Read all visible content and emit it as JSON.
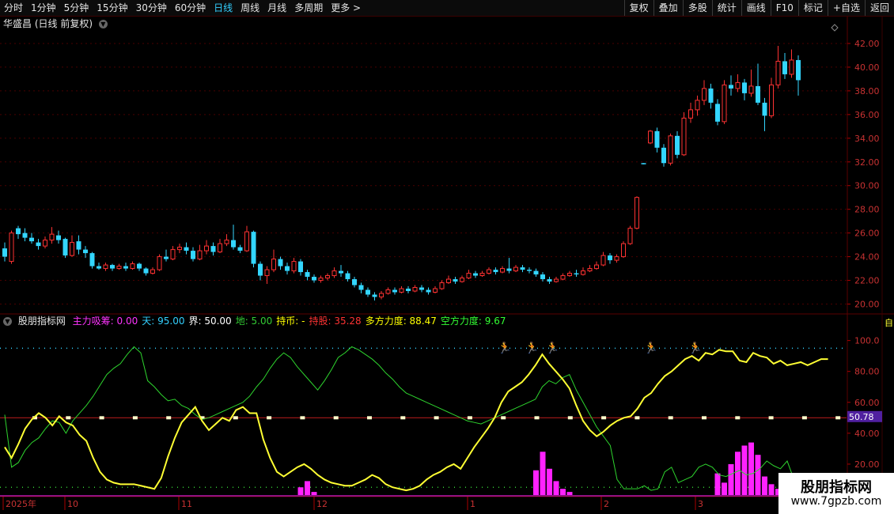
{
  "toolbar": {
    "periods": [
      "分时",
      "1分钟",
      "5分钟",
      "15分钟",
      "30分钟",
      "60分钟",
      "日线",
      "周线",
      "月线",
      "多周期",
      "更多 >"
    ],
    "active_index": 6,
    "tools": [
      "复权",
      "叠加",
      "多股",
      "统计",
      "画线",
      "F10",
      "标记",
      "+自选",
      "返回"
    ]
  },
  "title": {
    "name": "华盛昌",
    "mode": "(日线 前复权)"
  },
  "price_axis": [
    "42.00",
    "40.00",
    "38.00",
    "36.00",
    "34.00",
    "32.00",
    "30.00",
    "28.00",
    "26.00",
    "24.00",
    "22.00",
    "20.00"
  ],
  "indicator": {
    "name": "股朋指标网",
    "fields": [
      {
        "label": "主力吸筹:",
        "value": "0.00",
        "color": "#ff33ff"
      },
      {
        "label": "天:",
        "value": "95.00",
        "color": "#33d0ff"
      },
      {
        "label": "界:",
        "value": "50.00",
        "color": "#ffffff"
      },
      {
        "label": "地:",
        "value": "5.00",
        "color": "#33cc33"
      },
      {
        "label": "持币:",
        "value": "-",
        "color": "#ffff00"
      },
      {
        "label": "持股:",
        "value": "35.28",
        "color": "#ff3333"
      },
      {
        "label": "多方力度:",
        "value": "88.47",
        "color": "#ffff00"
      },
      {
        "label": "空方力度:",
        "value": "9.67",
        "color": "#33ff33"
      }
    ],
    "axis": [
      "100.0",
      "80.00",
      "60.00",
      "40.00",
      "20.00"
    ],
    "current_value": "50.78",
    "right_stub": "自"
  },
  "timeline": [
    "2025年",
    "10",
    "11",
    "12",
    "1",
    "2",
    "3"
  ],
  "watermark": {
    "line1": "股朋指标网",
    "line2": "www.7gpzb.com"
  },
  "colors": {
    "up": "#ff3232",
    "down": "#33d6ff",
    "yellow": "#ffff33",
    "green": "#2ed42e",
    "magenta": "#ff22ff"
  },
  "chart_data": {
    "type": "candlestick",
    "ylim": [
      19.5,
      43
    ],
    "candles": [
      [
        24.7,
        24.0,
        25.2,
        23.6
      ],
      [
        23.6,
        26.0,
        26.2,
        23.4
      ],
      [
        26.4,
        25.9,
        26.6,
        25.5
      ],
      [
        26.0,
        25.6,
        26.4,
        25.3
      ],
      [
        25.6,
        25.3,
        26.0,
        25.1
      ],
      [
        25.2,
        24.9,
        25.5,
        24.6
      ],
      [
        24.9,
        25.4,
        25.7,
        24.7
      ],
      [
        25.4,
        25.9,
        26.5,
        25.1
      ],
      [
        25.8,
        25.4,
        26.2,
        25.1
      ],
      [
        25.5,
        24.1,
        25.6,
        23.9
      ],
      [
        24.1,
        25.2,
        25.8,
        24.0
      ],
      [
        25.3,
        24.6,
        25.8,
        24.2
      ],
      [
        24.6,
        24.3,
        24.9,
        23.9
      ],
      [
        24.3,
        23.2,
        24.4,
        23.0
      ],
      [
        23.2,
        23.0,
        23.5,
        22.9
      ],
      [
        23.0,
        23.3,
        23.5,
        22.8
      ],
      [
        23.3,
        23.0,
        23.4,
        22.8
      ],
      [
        23.0,
        23.2,
        23.4,
        22.9
      ],
      [
        23.2,
        23.0,
        23.5,
        22.8
      ],
      [
        23.0,
        23.4,
        23.6,
        22.9
      ],
      [
        23.4,
        23.0,
        23.5,
        22.8
      ],
      [
        23.0,
        22.6,
        23.1,
        22.4
      ],
      [
        22.6,
        22.9,
        23.1,
        22.5
      ],
      [
        22.9,
        24.0,
        24.2,
        22.8
      ],
      [
        24.0,
        23.8,
        24.6,
        23.6
      ],
      [
        23.8,
        24.6,
        24.9,
        23.7
      ],
      [
        24.6,
        24.8,
        25.1,
        24.3
      ],
      [
        24.8,
        24.5,
        25.2,
        24.2
      ],
      [
        24.5,
        23.8,
        24.8,
        23.6
      ],
      [
        23.8,
        24.5,
        25.0,
        23.7
      ],
      [
        24.5,
        24.9,
        25.4,
        24.2
      ],
      [
        24.9,
        24.4,
        25.2,
        24.1
      ],
      [
        24.4,
        25.1,
        25.5,
        24.3
      ],
      [
        25.1,
        25.4,
        25.9,
        24.9
      ],
      [
        25.4,
        24.8,
        26.7,
        24.6
      ],
      [
        24.8,
        24.5,
        25.0,
        24.3
      ],
      [
        24.5,
        26.1,
        26.6,
        24.4
      ],
      [
        26.1,
        23.4,
        26.2,
        23.1
      ],
      [
        23.4,
        22.4,
        23.6,
        22.0
      ],
      [
        22.4,
        22.9,
        23.2,
        21.7
      ],
      [
        22.9,
        23.8,
        24.6,
        22.7
      ],
      [
        23.8,
        23.2,
        24.0,
        22.9
      ],
      [
        23.2,
        22.8,
        23.5,
        22.5
      ],
      [
        22.8,
        23.6,
        23.9,
        22.6
      ],
      [
        23.6,
        22.7,
        23.8,
        22.4
      ],
      [
        22.7,
        22.3,
        22.9,
        22.0
      ],
      [
        22.3,
        22.0,
        22.5,
        21.8
      ],
      [
        22.0,
        22.2,
        22.4,
        21.8
      ],
      [
        22.2,
        22.4,
        22.6,
        22.0
      ],
      [
        22.4,
        22.8,
        23.1,
        22.2
      ],
      [
        22.8,
        22.6,
        23.3,
        22.3
      ],
      [
        22.6,
        22.1,
        22.8,
        21.9
      ],
      [
        22.1,
        21.6,
        22.3,
        21.4
      ],
      [
        21.6,
        21.2,
        21.8,
        20.9
      ],
      [
        21.2,
        20.8,
        21.4,
        20.6
      ],
      [
        20.8,
        20.6,
        21.0,
        20.3
      ],
      [
        20.6,
        20.9,
        21.1,
        20.4
      ],
      [
        20.9,
        21.2,
        21.4,
        20.8
      ],
      [
        21.2,
        21.0,
        21.4,
        20.8
      ],
      [
        21.0,
        21.3,
        21.5,
        20.9
      ],
      [
        21.3,
        21.1,
        21.5,
        20.9
      ],
      [
        21.1,
        21.4,
        21.6,
        21.0
      ],
      [
        21.4,
        21.2,
        21.6,
        21.0
      ],
      [
        21.2,
        21.0,
        21.4,
        20.8
      ],
      [
        21.0,
        21.3,
        21.5,
        20.9
      ],
      [
        21.3,
        21.8,
        22.0,
        21.2
      ],
      [
        21.8,
        22.1,
        22.4,
        21.7
      ],
      [
        22.1,
        21.9,
        22.3,
        21.7
      ],
      [
        21.9,
        22.2,
        22.4,
        21.8
      ],
      [
        22.2,
        22.6,
        22.9,
        22.1
      ],
      [
        22.6,
        22.4,
        22.8,
        22.2
      ],
      [
        22.4,
        22.6,
        22.8,
        22.3
      ],
      [
        22.6,
        22.9,
        23.1,
        22.5
      ],
      [
        22.9,
        22.7,
        23.1,
        22.5
      ],
      [
        22.7,
        23.0,
        23.2,
        22.6
      ],
      [
        23.0,
        22.8,
        23.9,
        22.6
      ],
      [
        22.8,
        23.1,
        23.3,
        22.7
      ],
      [
        23.1,
        22.9,
        23.3,
        22.7
      ],
      [
        22.9,
        22.8,
        23.1,
        22.6
      ],
      [
        22.8,
        22.5,
        23.0,
        22.3
      ],
      [
        22.5,
        22.1,
        22.7,
        21.9
      ],
      [
        22.1,
        21.9,
        22.3,
        21.7
      ],
      [
        21.9,
        22.1,
        22.3,
        21.8
      ],
      [
        22.1,
        22.4,
        22.6,
        22.0
      ],
      [
        22.4,
        22.6,
        22.8,
        22.3
      ],
      [
        22.6,
        22.5,
        22.9,
        22.3
      ],
      [
        22.5,
        22.8,
        23.1,
        22.4
      ],
      [
        22.8,
        23.0,
        23.3,
        22.7
      ],
      [
        23.0,
        23.3,
        23.6,
        22.9
      ],
      [
        23.3,
        24.1,
        24.4,
        23.2
      ],
      [
        24.1,
        23.7,
        24.3,
        23.4
      ],
      [
        23.7,
        24.0,
        24.2,
        23.5
      ],
      [
        24.0,
        25.1,
        25.3,
        23.9
      ],
      [
        25.1,
        26.4,
        26.6,
        25.0
      ],
      [
        26.4,
        29.0,
        29.1,
        26.3
      ],
      [
        31.9,
        31.8,
        31.9,
        31.8
      ],
      [
        33.6,
        34.6,
        34.7,
        33.5
      ],
      [
        34.6,
        33.2,
        34.9,
        32.8
      ],
      [
        33.2,
        31.9,
        33.5,
        31.6
      ],
      [
        31.9,
        34.2,
        34.4,
        31.7
      ],
      [
        34.2,
        32.6,
        34.6,
        32.3
      ],
      [
        32.6,
        35.7,
        36.2,
        32.5
      ],
      [
        35.7,
        36.4,
        37.0,
        35.3
      ],
      [
        36.4,
        37.2,
        37.6,
        35.9
      ],
      [
        37.2,
        38.2,
        38.9,
        36.8
      ],
      [
        38.2,
        37.0,
        38.6,
        36.5
      ],
      [
        36.9,
        35.4,
        37.3,
        35.1
      ],
      [
        35.4,
        38.5,
        38.9,
        35.2
      ],
      [
        38.5,
        38.2,
        39.3,
        37.6
      ],
      [
        38.2,
        38.7,
        39.4,
        37.9
      ],
      [
        38.7,
        37.8,
        39.0,
        37.2
      ],
      [
        37.8,
        38.4,
        39.8,
        37.5
      ],
      [
        38.4,
        37.0,
        40.3,
        36.8
      ],
      [
        37.0,
        35.9,
        37.4,
        34.6
      ],
      [
        35.9,
        38.5,
        39.1,
        35.7
      ],
      [
        38.5,
        40.5,
        41.8,
        38.2
      ],
      [
        40.5,
        39.4,
        41.2,
        39.0
      ],
      [
        39.4,
        40.6,
        41.5,
        39.1
      ],
      [
        40.6,
        38.9,
        41.0,
        37.6
      ]
    ],
    "indicator_series": {
      "yellow": [
        31,
        24,
        33,
        43,
        49,
        53,
        50,
        45,
        51,
        47,
        45,
        39,
        35,
        24,
        15,
        10,
        8,
        7,
        7,
        7,
        6,
        5,
        4,
        11,
        25,
        37,
        47,
        52,
        57,
        48,
        42,
        46,
        50,
        48,
        55,
        57,
        53,
        53,
        36,
        24,
        15,
        12,
        15,
        18,
        20,
        17,
        13,
        10,
        8,
        7,
        6,
        6,
        8,
        10,
        13,
        11,
        7,
        5,
        4,
        3,
        4,
        6,
        10,
        13,
        15,
        18,
        20,
        17,
        24,
        31,
        37,
        43,
        50,
        60,
        67,
        70,
        73,
        78,
        84,
        91,
        85,
        80,
        75,
        69,
        58,
        48,
        42,
        38,
        41,
        45,
        48,
        50,
        51,
        56,
        63,
        66,
        72,
        77,
        80,
        84,
        88,
        90,
        87,
        92,
        91,
        94,
        93,
        93,
        87,
        86,
        92,
        90,
        89,
        85,
        87,
        84,
        85,
        86,
        84,
        86,
        88,
        88
      ],
      "green": [
        52,
        18,
        21,
        29,
        34,
        37,
        43,
        48,
        47,
        40,
        48,
        53,
        58,
        64,
        71,
        78,
        82,
        85,
        91,
        96,
        92,
        74,
        70,
        65,
        61,
        62,
        58,
        56,
        52,
        49,
        50,
        52,
        54,
        56,
        58,
        60,
        64,
        70,
        75,
        82,
        88,
        92,
        89,
        83,
        78,
        73,
        68,
        74,
        81,
        89,
        92,
        96,
        94,
        91,
        88,
        84,
        79,
        75,
        70,
        66,
        64,
        62,
        60,
        58,
        56,
        54,
        52,
        50,
        48,
        47,
        46,
        48,
        50,
        52,
        54,
        56,
        58,
        60,
        62,
        70,
        74,
        72,
        76,
        78,
        68,
        60,
        52,
        44,
        38,
        32,
        10,
        4,
        4,
        4,
        6,
        3,
        4,
        15,
        18,
        8,
        10,
        12,
        18,
        20,
        18,
        13,
        12,
        14,
        16,
        13,
        14,
        17,
        22,
        19,
        17,
        22,
        10,
        8,
        6
      ]
    },
    "magenta_bars": [
      [
        44,
        5
      ],
      [
        45,
        9
      ],
      [
        46,
        2
      ],
      [
        79,
        16
      ],
      [
        80,
        28
      ],
      [
        81,
        17
      ],
      [
        82,
        9
      ],
      [
        83,
        4
      ],
      [
        84,
        2
      ],
      [
        106,
        14
      ],
      [
        107,
        8
      ],
      [
        108,
        20
      ],
      [
        109,
        28
      ],
      [
        110,
        32
      ],
      [
        111,
        34
      ],
      [
        112,
        26
      ],
      [
        113,
        12
      ],
      [
        114,
        7
      ],
      [
        115,
        4
      ],
      [
        116,
        2
      ],
      [
        117,
        1
      ]
    ],
    "signal_markers": [
      147,
      155,
      161,
      190,
      203
    ]
  }
}
